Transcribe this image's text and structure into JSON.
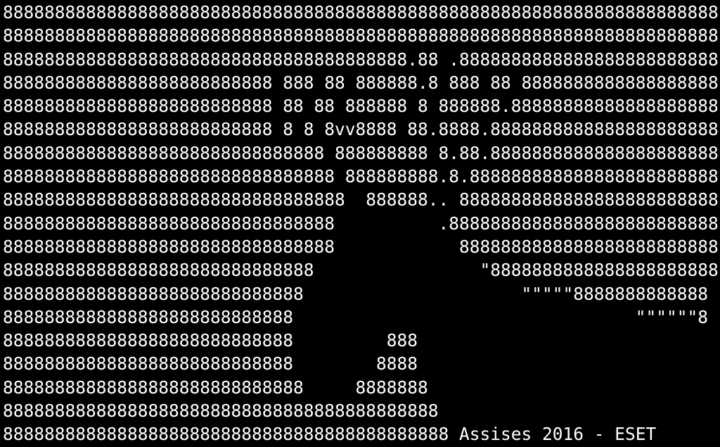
{
  "terminal": {
    "background": "#000000",
    "foreground": "#ffffff",
    "lines": [
      "888888888888888888888888888888888888888888888888888888888888888888888",
      "888888888888888888888888888888888888888888888888888888888888888888888",
      "888888888888888888888888888888888888888.88 .8888888888888888888888888",
      "88888888888888888888888888 888 88 888888.8 888 88 8888888888888888888",
      "88888888888888888888888888 88 88 888888 8 888888.88888888888888888888",
      "88888888888888888888888888 8 8 8vv8888 88.8888.8888888888888888888888",
      "8888888888888888888888888888888 888888888 8.88.8888888888888888888888",
      "88888888888888888888888888888888 888888888.8.888888888888888888888888",
      "888888888888888888888888888888888  888888.. 8888888888888888888888888",
      "88888888888888888888888888888888          .88888888888888888888888888",
      "88888888888888888888888888888888            8888888888888888888888888",
      "888888888888888888888888888888                \"8888888888888888888888",
      "88888888888888888888888888888                     \"\"\"\"\"8888888888888",
      "8888888888888888888888888888                                 \"\"\"\"\"\"8",
      "8888888888888888888888888888         888",
      "8888888888888888888888888888        8888",
      "88888888888888888888888888888     8888888",
      "888888888888888888888888888888888888888888",
      "8888888888888888888888888888888888888888888 "
    ],
    "caption": "Assises 2016 - ESET"
  }
}
